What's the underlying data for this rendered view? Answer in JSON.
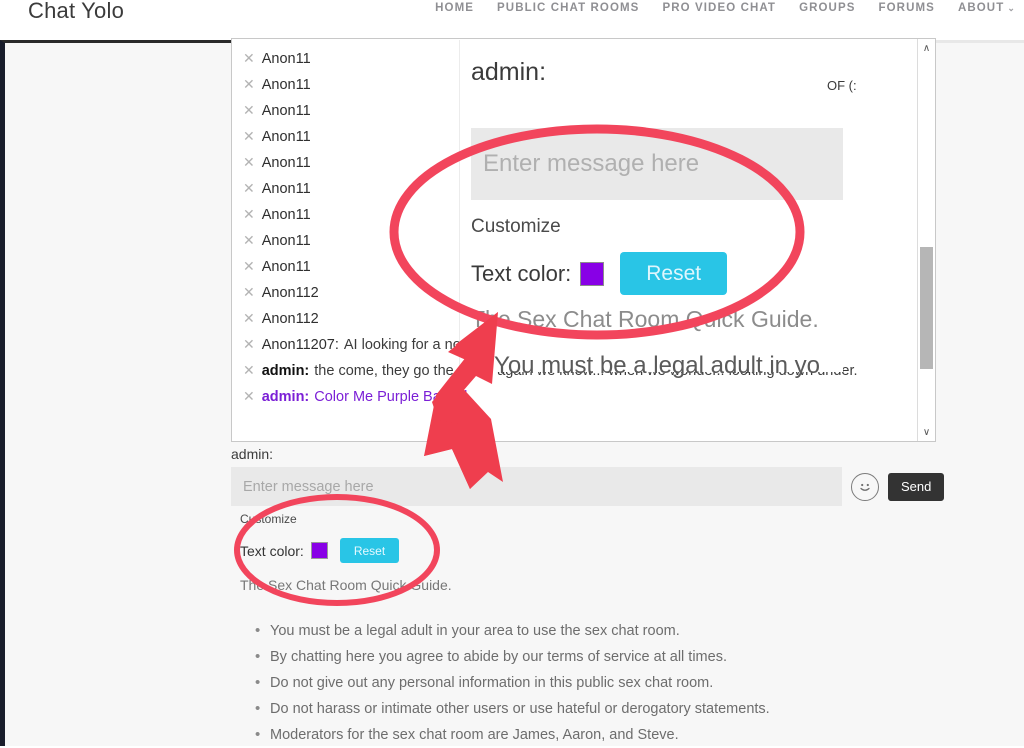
{
  "header": {
    "brand": "Chat Yolo",
    "nav": [
      {
        "label": "HOME",
        "caret": ""
      },
      {
        "label": "PUBLIC CHAT ROOMS",
        "caret": ""
      },
      {
        "label": "PRO VIDEO CHAT",
        "caret": ""
      },
      {
        "label": "GROUPS",
        "caret": ""
      },
      {
        "label": "FORUMS",
        "caret": ""
      },
      {
        "label": "ABOUT",
        "caret": "⌄"
      }
    ]
  },
  "chat": {
    "close_glyph": "✕",
    "scroll_up_glyph": "∧",
    "scroll_down_glyph": "∨",
    "messages": [
      {
        "user": "Anon11",
        "text": "",
        "bold": false,
        "colored": false
      },
      {
        "user": "Anon11",
        "text": "",
        "bold": false,
        "colored": false
      },
      {
        "user": "Anon11",
        "text": "",
        "bold": false,
        "colored": false
      },
      {
        "user": "Anon11",
        "text": "",
        "bold": false,
        "colored": false
      },
      {
        "user": "Anon11",
        "text": "",
        "bold": false,
        "colored": false
      },
      {
        "user": "Anon11",
        "text": "",
        "bold": false,
        "colored": false
      },
      {
        "user": "Anon11",
        "text": "",
        "bold": false,
        "colored": false
      },
      {
        "user": "Anon11",
        "text": "",
        "bold": false,
        "colored": false
      },
      {
        "user": "Anon11",
        "text": "",
        "bold": false,
        "colored": false
      },
      {
        "user": "Anon112",
        "text": "",
        "bold": false,
        "colored": false
      },
      {
        "user": "Anon112",
        "text": "",
        "bold": false,
        "colored": false
      },
      {
        "user": "Anon11207:",
        "text": "AI looking for a non existent female",
        "bold": false,
        "colored": false
      },
      {
        "user": "admin:",
        "text": "the come, they go the come again we know... when we wonder.. looking down under.",
        "bold": true,
        "colored": false
      },
      {
        "user": "admin:",
        "text": "Color Me Purple BatGirl",
        "bold": true,
        "colored": true
      }
    ]
  },
  "composer": {
    "username": "admin:",
    "placeholder": "Enter message here",
    "value": "",
    "emoji_icon": "smiley-face-icon",
    "send_label": "Send"
  },
  "customize": {
    "title": "Customize",
    "text_color_label": "Text color:",
    "swatch_color": "#8800e6",
    "reset_label": "Reset",
    "quick_guide": "The Sex Chat Room Quick Guide."
  },
  "rules": {
    "bullet": "•",
    "items": [
      "You must be a legal adult in your area to use the sex chat room.",
      "By chatting here you agree to abide by our terms of service at all times.",
      "Do not give out any personal information in this public sex chat room.",
      "Do not harass or intimate other users or use hateful or derogatory statements.",
      "Moderators for the sex chat room are James, Aaron, and Steve."
    ]
  },
  "magnifier": {
    "username": "admin:",
    "placeholder": "Enter message here",
    "customize_title": "Customize",
    "text_color_label": "Text color:",
    "reset_label": "Reset",
    "quick_guide": "The Sex Chat Room Quick Guide.",
    "rule_excerpt": "You must be a legal adult in yo",
    "bullet": "•",
    "tail_text": "OF (:"
  },
  "annotation": {
    "highlight_color": "#f2455c",
    "arrow_color": "#ef3e4e"
  }
}
